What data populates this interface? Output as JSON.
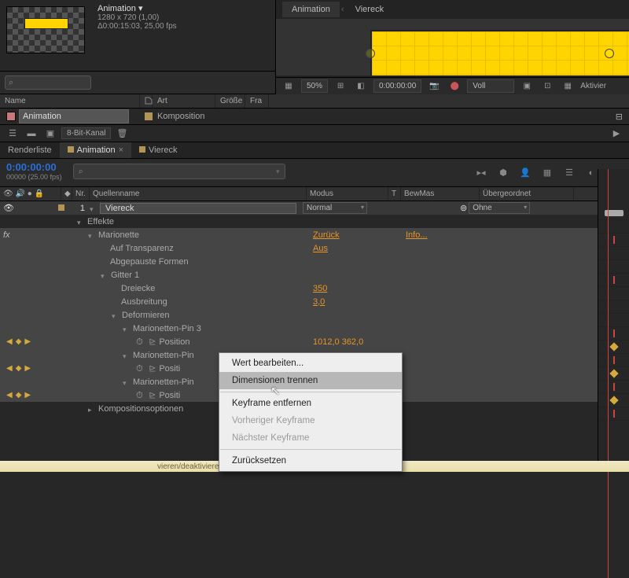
{
  "comp": {
    "name": "Animation ▾",
    "dims": "1280 x 720 (1,00)",
    "dur": "Δ0:00:15:03, 25,00 fps"
  },
  "viewer_tabs": [
    "Animation",
    "Viereck"
  ],
  "viewer_foot": {
    "zoom": "50%",
    "time": "0:00:00:00",
    "res": "Voll",
    "btn": "Aktivier"
  },
  "search_icon": "⌕",
  "proj_headers": {
    "name": "Name",
    "type": "Art",
    "size": "Größe",
    "fr": "Fra"
  },
  "proj_items": {
    "animation": "Animation",
    "viereck": "Komposition"
  },
  "bitdepth": "8-Bit-Kanal",
  "tabs": {
    "render": "Renderliste",
    "anim": "Animation",
    "viereck": "Viereck"
  },
  "timecode": "0:00:00:00",
  "timecode_sub": "00000 (25.00 fps)",
  "columns": {
    "switches": "",
    "nr": "Nr.",
    "quelle": "Quellenname",
    "modus": "Modus",
    "t": "T",
    "bewmas": "BewMas",
    "parent": "Übergeordnet"
  },
  "layer": {
    "nr": "1",
    "name": "Viereck",
    "mode": "Normal",
    "parent": "Ohne"
  },
  "rows": {
    "effekte": "Effekte",
    "marionette": "Marionette",
    "aufTransparenz": "Auf Transparenz",
    "abgepauste": "Abgepauste Formen",
    "gitter": "Gitter 1",
    "dreiecke": "Dreiecke",
    "ausbreitung": "Ausbreitung",
    "deformieren": "Deformieren",
    "pin3": "Marionetten-Pin 3",
    "position": "Position",
    "pin2": "Marionetten-Pin",
    "pin1": "Marionetten-Pin",
    "kompOptionen": "Kompositionsoptionen"
  },
  "vals": {
    "zurueck": "Zurück",
    "info": "Info...",
    "aus": "Aus",
    "dreiecke": "350",
    "ausbreitung": "3,0",
    "position3": "1012,0 362,0",
    "posit": "Positi"
  },
  "menu": {
    "edit": "Wert bearbeiten...",
    "separate": "Dimensionen trennen",
    "remove": "Keyframe entfernen",
    "prev": "Vorheriger Keyframe",
    "next": "Nächster Keyframe",
    "reset": "Zurücksetzen"
  },
  "footer": "vieren/deaktivieren"
}
